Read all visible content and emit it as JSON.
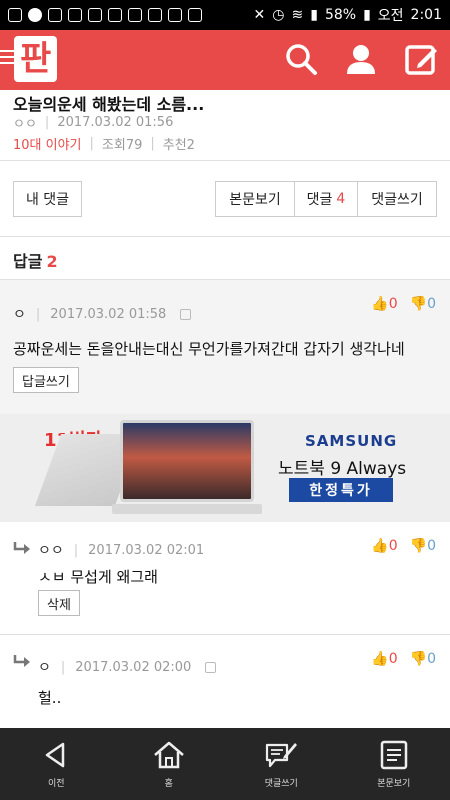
{
  "status_bar": {
    "battery": "58%",
    "period": "오전",
    "time": "2:01"
  },
  "header": {
    "logo": "판",
    "icons": [
      "search-icon",
      "user-icon",
      "write-icon"
    ]
  },
  "article": {
    "title": "오늘의운세 해봤는데 소름...",
    "author": "ㅇㅇ",
    "date": "2017.03.02 01:56",
    "category": "10대 이야기",
    "views": "조회79",
    "recommend": "추천2"
  },
  "actions": {
    "my_comments": "내 댓글",
    "view_post": "본문보기",
    "comments_label": "댓글",
    "comments_count": "4",
    "write_comment": "댓글쓰기"
  },
  "replies": {
    "label": "답글",
    "count": "2"
  },
  "main_comment": {
    "author": "ㅇ",
    "date": "2017.03.02 01:58",
    "up": "0",
    "down": "0",
    "text": "공짜운세는 돈을안내는대신 무언가를가져간대 갑자기 생각나네",
    "reply_button": "답글쓰기"
  },
  "ad": {
    "tag": "11번가",
    "brand": "SAMSUNG",
    "product": "노트북 9 Always",
    "sale": "한정특가"
  },
  "reply1": {
    "author": "ㅇㅇ",
    "date": "2017.03.02 02:01",
    "up": "0",
    "down": "0",
    "text": "ㅅㅂ 무섭게 왜그래",
    "delete_button": "삭제"
  },
  "reply2": {
    "author": "ㅇ",
    "date": "2017.03.02 02:00",
    "up": "0",
    "down": "0",
    "text": "헐.."
  },
  "bottom_nav": {
    "items": [
      {
        "label": "이전",
        "icon": "back-icon"
      },
      {
        "label": "홈",
        "icon": "home-icon"
      },
      {
        "label": "댓글쓰기",
        "icon": "comment-write-icon"
      },
      {
        "label": "본문보기",
        "icon": "document-icon"
      }
    ]
  }
}
